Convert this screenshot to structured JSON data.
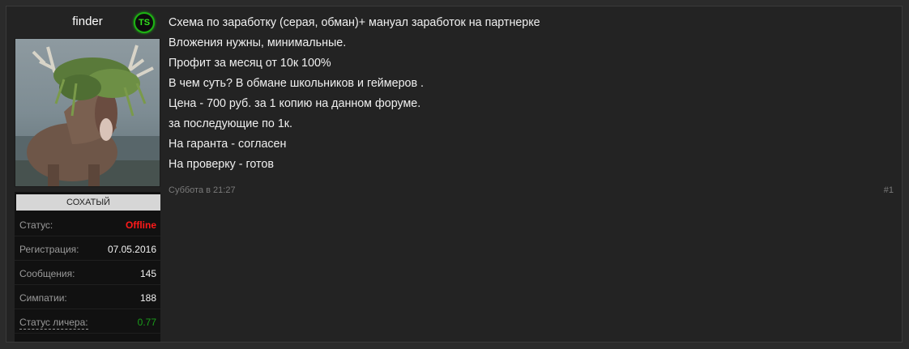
{
  "user": {
    "username": "finder",
    "badge": "TS",
    "rank": "СОХАТЫЙ",
    "stats": [
      {
        "label": "Статус:",
        "value": "Offline"
      },
      {
        "label": "Регистрация:",
        "value": "07.05.2016"
      },
      {
        "label": "Сообщения:",
        "value": "145"
      },
      {
        "label": "Симпатии:",
        "value": "188"
      },
      {
        "label": "Статус личера:",
        "value": "0.77"
      }
    ]
  },
  "post": {
    "lines": [
      "Схема по заработку (серая, обман)+ мануал заработок на партнерке",
      "Вложения нужны, минимальные.",
      "Профит за месяц от 10к 100%",
      "В чем суть? В обмане школьников и геймеров .",
      "Цена - 700 руб. за 1 копию на данном форуме.",
      "за последующие по 1к.",
      "На гаранта - согласен",
      "На проверку - готов"
    ],
    "date": "Суббота в 21:27",
    "number": "#1"
  },
  "colors": {
    "offline": "#ff1a1a",
    "leecher": "#1a9e1a",
    "badge": "#1db313"
  }
}
